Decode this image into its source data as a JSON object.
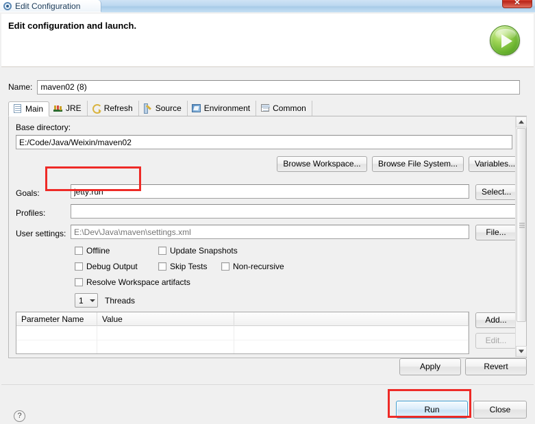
{
  "window": {
    "title": "Edit Configuration",
    "title_icon": "gear-icon",
    "close_label": "✕"
  },
  "header": {
    "title": "Edit configuration and launch.",
    "badge_icon": "green-run-play-icon"
  },
  "name_field": {
    "label": "Name:",
    "value": "maven02 (8)"
  },
  "tabs": [
    {
      "label": "Main",
      "icon": "document-icon",
      "active": true
    },
    {
      "label": "JRE",
      "icon": "books-icon",
      "active": false
    },
    {
      "label": "Refresh",
      "icon": "refresh-icon",
      "active": false
    },
    {
      "label": "Source",
      "icon": "source-folder-icon",
      "active": false
    },
    {
      "label": "Environment",
      "icon": "environment-icon",
      "active": false
    },
    {
      "label": "Common",
      "icon": "common-window-icon",
      "active": false
    }
  ],
  "main_tab": {
    "base_directory": {
      "label": "Base directory:",
      "value": "E:/Code/Java/Weixin/maven02"
    },
    "browse_buttons": [
      {
        "label": "Browse Workspace..."
      },
      {
        "label": "Browse File System..."
      },
      {
        "label": "Variables..."
      }
    ],
    "goals": {
      "label": "Goals:",
      "value": "jetty:run",
      "button": "Select...",
      "highlighted": true
    },
    "profiles": {
      "label": "Profiles:",
      "value": ""
    },
    "user_settings": {
      "label": "User settings:",
      "placeholder": "E:\\Dev\\Java\\maven\\settings.xml",
      "value": "",
      "button": "File..."
    },
    "checkboxes": [
      {
        "label": "Offline",
        "checked": false
      },
      {
        "label": "Update Snapshots",
        "checked": false
      },
      {
        "label": "Debug Output",
        "checked": false
      },
      {
        "label": "Skip Tests",
        "checked": false
      },
      {
        "label": "Non-recursive",
        "checked": false
      },
      {
        "label": "Resolve Workspace artifacts",
        "checked": false
      }
    ],
    "threads": {
      "value": "1",
      "label": "Threads"
    },
    "parameters_table": {
      "columns": [
        "Parameter Name",
        "Value"
      ],
      "rows": [],
      "buttons": [
        {
          "label": "Add...",
          "enabled": true
        },
        {
          "label": "Edit...",
          "enabled": false
        }
      ]
    }
  },
  "footer": {
    "apply_label": "Apply",
    "revert_label": "Revert",
    "run_label": "Run",
    "close_label": "Close",
    "help_label": "?",
    "run_highlighted": true
  },
  "colors": {
    "annotation_red": "#ee2a26",
    "default_button_border": "#3c9cd0",
    "run_badge_green": "#63ae2a",
    "titlebar_blue": "#bcd8f0"
  }
}
